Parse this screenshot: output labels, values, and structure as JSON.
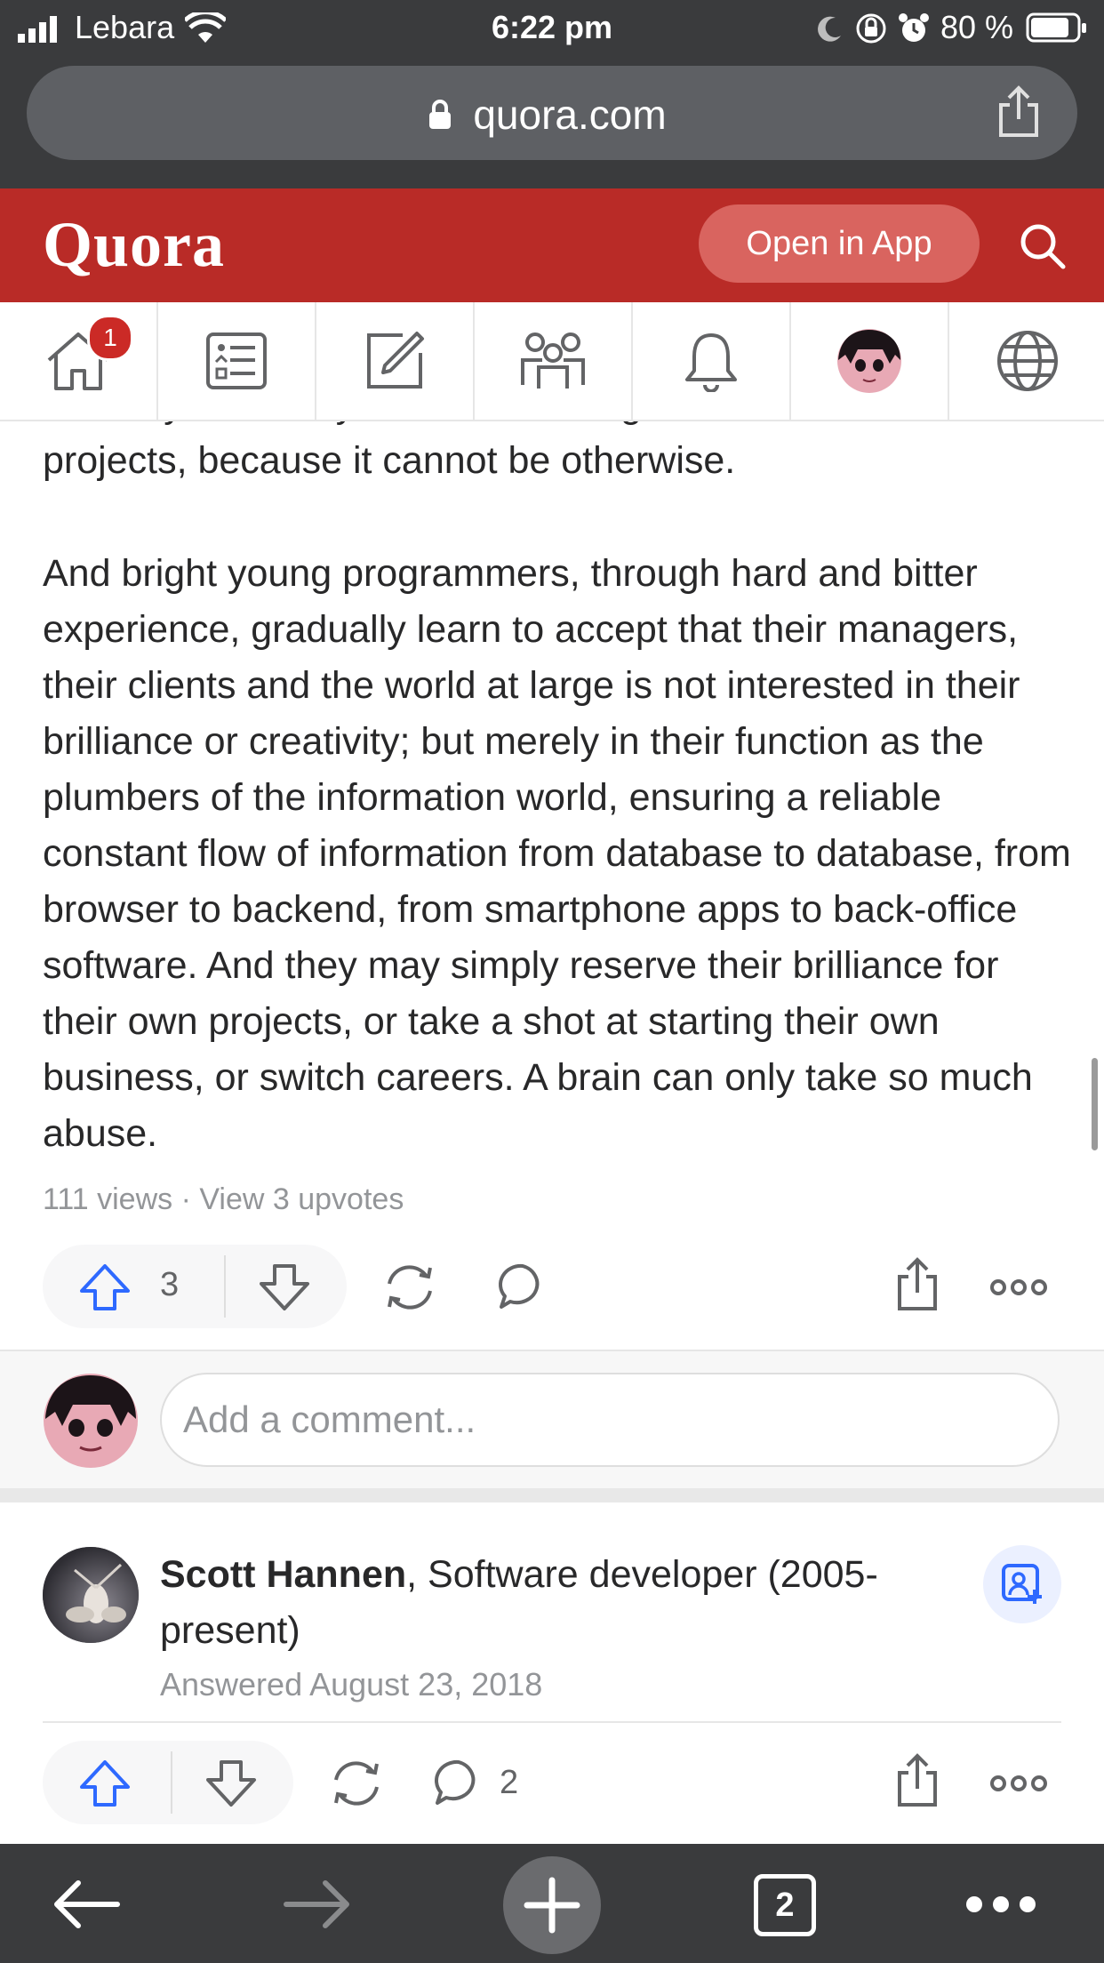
{
  "status_bar": {
    "carrier": "Lebara",
    "time": "6:22 pm",
    "battery": "80 %"
  },
  "browser": {
    "url": "quora.com",
    "tab_count": "2"
  },
  "header": {
    "logo": "Quora",
    "open_in_app": "Open in App"
  },
  "nav": {
    "home_badge": "1"
  },
  "article": {
    "para1": "intimacy is entirely absent from large-scale collaborative projects, because it cannot be otherwise.",
    "para2": "And bright young programmers, through hard and bitter experience, gradually learn to accept that their managers, their clients and the world at large is not interested in their brilliance or creativity; but merely in their function as the plumbers of the information world, ensuring a reliable constant flow of information from database to database, from browser to backend, from smartphone apps to back-office software. And they may simply reserve their brilliance for their own projects, or take a shot at starting their own business, or switch careers. A brain can only take so much abuse.",
    "stats": "111 views · View 3 upvotes",
    "upvote_count": "3"
  },
  "comment": {
    "placeholder": "Add a comment..."
  },
  "next_answer": {
    "author": "Scott Hannen",
    "credential": ", Software developer (2005-present)",
    "answered": "Answered August 23, 2018",
    "comment_count": "2"
  },
  "colors": {
    "brand": "#b92b27",
    "upvote_blue": "#2e69ff"
  }
}
